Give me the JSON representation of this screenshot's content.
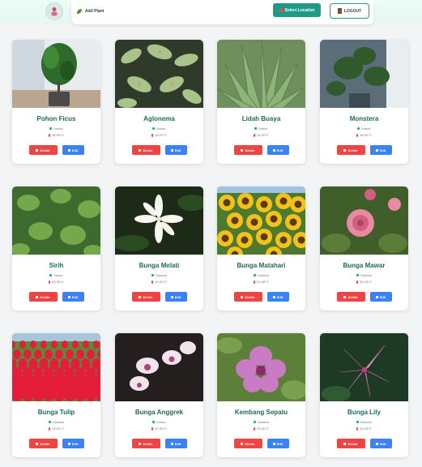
{
  "header": {
    "add_plant_label": "Add Plant",
    "select_location_label": "Select Location",
    "logout_label": "LOGOUT"
  },
  "actions": {
    "delete_label": "Delete",
    "edit_label": "Edit"
  },
  "colors": {
    "brand": "#1f9a86",
    "title": "#1f6b56",
    "delete": "#ef4444",
    "edit": "#3b82f6"
  },
  "plants": [
    {
      "name": "Pohon Ficus",
      "environment": "Indoor",
      "temperature": "15-25°C",
      "image": "ficus"
    },
    {
      "name": "Aglonema",
      "environment": "Indoor",
      "temperature": "18-24°C",
      "image": "aglonema"
    },
    {
      "name": "Lidah Buaya",
      "environment": "Indoor",
      "temperature": "15-30°C",
      "image": "aloe"
    },
    {
      "name": "Monstera",
      "environment": "Indoor",
      "temperature": "18-30°C",
      "image": "monstera"
    },
    {
      "name": "Sirih",
      "environment": "Indoor",
      "temperature": "20-30°C",
      "image": "sirih"
    },
    {
      "name": "Bunga Melati",
      "environment": "Outdoor",
      "temperature": "15-30°C",
      "image": "jasmine"
    },
    {
      "name": "Bunga Matahari",
      "environment": "Outdoor",
      "temperature": "20-30°C",
      "image": "sunflower"
    },
    {
      "name": "Bunga Mawar",
      "environment": "Outdoor",
      "temperature": "20-25°C",
      "image": "rose"
    },
    {
      "name": "Bunga Tulip",
      "environment": "Outdoor",
      "temperature": "15-20°C",
      "image": "tulip"
    },
    {
      "name": "Bunga Anggrek",
      "environment": "Indoor",
      "temperature": "20-30°C",
      "image": "orchid"
    },
    {
      "name": "Kembang Sepatu",
      "environment": "Outdoor",
      "temperature": "20-30°C",
      "image": "hibiscus"
    },
    {
      "name": "Bunga Lily",
      "environment": "Outdoor",
      "temperature": "15-25°C",
      "image": "lily"
    }
  ]
}
